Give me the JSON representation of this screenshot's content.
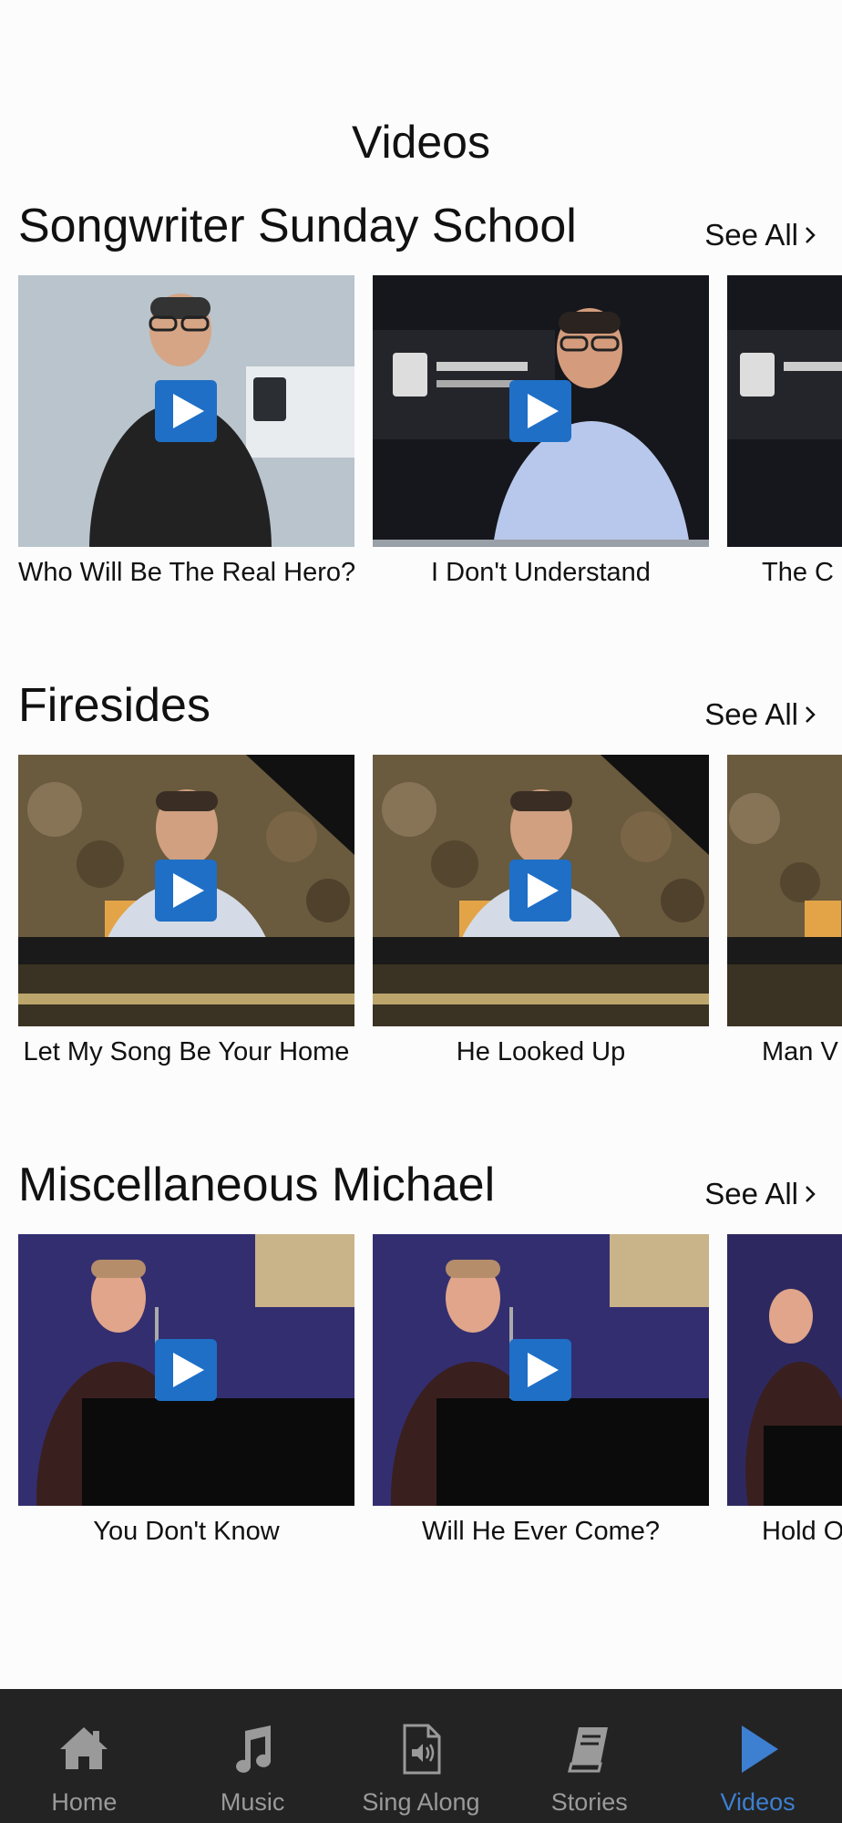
{
  "page": {
    "title": "Videos"
  },
  "sections": [
    {
      "title": "Songwriter Sunday School",
      "see_all": "See All",
      "videos": [
        {
          "title": "Who Will Be The Real Hero?"
        },
        {
          "title": "I Don't Understand"
        },
        {
          "title": "The C"
        }
      ]
    },
    {
      "title": "Firesides",
      "see_all": "See All",
      "videos": [
        {
          "title": "Let My Song Be Your Home"
        },
        {
          "title": "He Looked Up"
        },
        {
          "title": "Man V"
        }
      ]
    },
    {
      "title": "Miscellaneous Michael",
      "see_all": "See All",
      "videos": [
        {
          "title": "You Don't Know"
        },
        {
          "title": "Will He Ever Come?"
        },
        {
          "title": "Hold O"
        }
      ]
    }
  ],
  "tabbar": {
    "items": [
      {
        "label": "Home",
        "icon": "home-icon"
      },
      {
        "label": "Music",
        "icon": "music-note-icon"
      },
      {
        "label": "Sing Along",
        "icon": "audio-file-icon"
      },
      {
        "label": "Stories",
        "icon": "book-icon"
      },
      {
        "label": "Videos",
        "icon": "play-icon",
        "active": true
      }
    ]
  },
  "colors": {
    "accent": "#3d7fd0",
    "play_button": "#1f6fc6",
    "tabbar_bg": "#232323",
    "tab_inactive": "#9a9a9a"
  }
}
